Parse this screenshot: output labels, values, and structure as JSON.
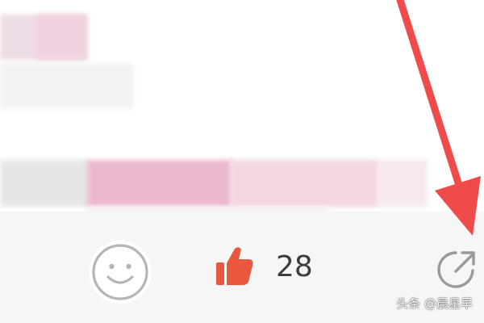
{
  "post": {
    "like_count": "28"
  },
  "icons": {
    "emoji": "smiley-face-icon",
    "like": "thumbs-up-icon",
    "share": "share-arrow-icon",
    "annotation": "red-pointer-arrow"
  },
  "colors": {
    "like_red": "#e9573f",
    "annotation_red": "#ef4b4b",
    "icon_gray": "#b5b5b5",
    "bar_background": "#f6f6f6"
  },
  "watermark": "头条 @晨星早"
}
